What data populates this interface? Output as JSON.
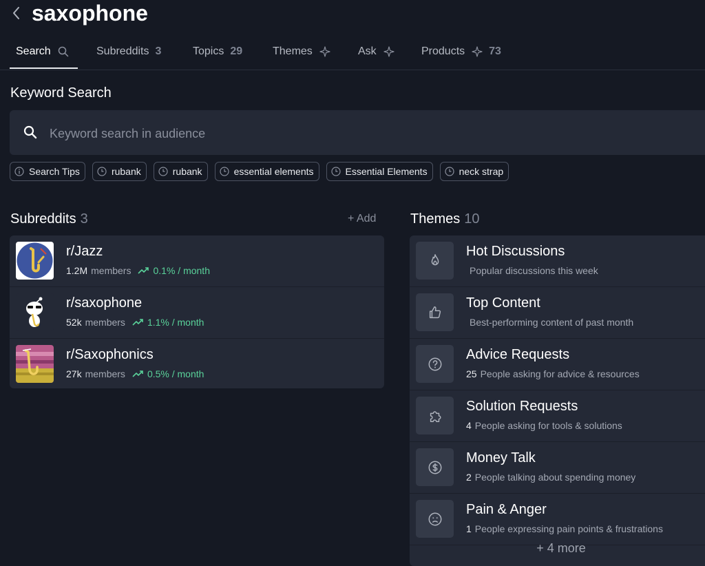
{
  "header": {
    "title": "saxophone"
  },
  "tabs": [
    {
      "label": "Search",
      "icon": "search-icon"
    },
    {
      "label": "Subreddits",
      "count": "3"
    },
    {
      "label": "Topics",
      "count": "29"
    },
    {
      "label": "Themes",
      "icon": "sparkle-icon"
    },
    {
      "label": "Ask",
      "icon": "sparkle-icon"
    },
    {
      "label": "Products",
      "icon": "sparkle-icon",
      "count": "73"
    }
  ],
  "keyword_search": {
    "title": "Keyword Search",
    "placeholder": "Keyword search in audience",
    "value": "",
    "pills": [
      {
        "label": "Search Tips",
        "icon": "info-icon"
      },
      {
        "label": "rubank",
        "icon": "clock-icon"
      },
      {
        "label": "rubank",
        "icon": "clock-icon"
      },
      {
        "label": "essential elements",
        "icon": "clock-icon"
      },
      {
        "label": "Essential Elements",
        "icon": "clock-icon"
      },
      {
        "label": "neck strap",
        "icon": "clock-icon"
      }
    ]
  },
  "subreddits": {
    "title": "Subreddits",
    "count": "3",
    "add_label": "+ Add",
    "members_label": "members",
    "items": [
      {
        "name": "r/Jazz",
        "members": "1.2M",
        "growth": "0.1% / month"
      },
      {
        "name": "r/saxophone",
        "members": "52k",
        "growth": "1.1% / month"
      },
      {
        "name": "r/Saxophonics",
        "members": "27k",
        "growth": "0.5% / month"
      }
    ]
  },
  "themes": {
    "title": "Themes",
    "count": "10",
    "items": [
      {
        "name": "Hot Discussions",
        "count": "",
        "desc": "Popular discussions this week",
        "icon": "flame-icon"
      },
      {
        "name": "Top Content",
        "count": "",
        "desc": "Best-performing content of past month",
        "icon": "thumbs-up-icon"
      },
      {
        "name": "Advice Requests",
        "count": "25",
        "desc": "People asking for advice & resources",
        "icon": "question-icon"
      },
      {
        "name": "Solution Requests",
        "count": "4",
        "desc": "People asking for tools & solutions",
        "icon": "puzzle-icon"
      },
      {
        "name": "Money Talk",
        "count": "2",
        "desc": "People talking about spending money",
        "icon": "dollar-icon"
      },
      {
        "name": "Pain & Anger",
        "count": "1",
        "desc": "People expressing pain points & frustrations",
        "icon": "sad-face-icon"
      }
    ],
    "more_label": "+ 4 more"
  },
  "colors": {
    "background": "#151923",
    "card": "#242936",
    "growth": "#5ad29a",
    "muted": "#7f8593"
  }
}
